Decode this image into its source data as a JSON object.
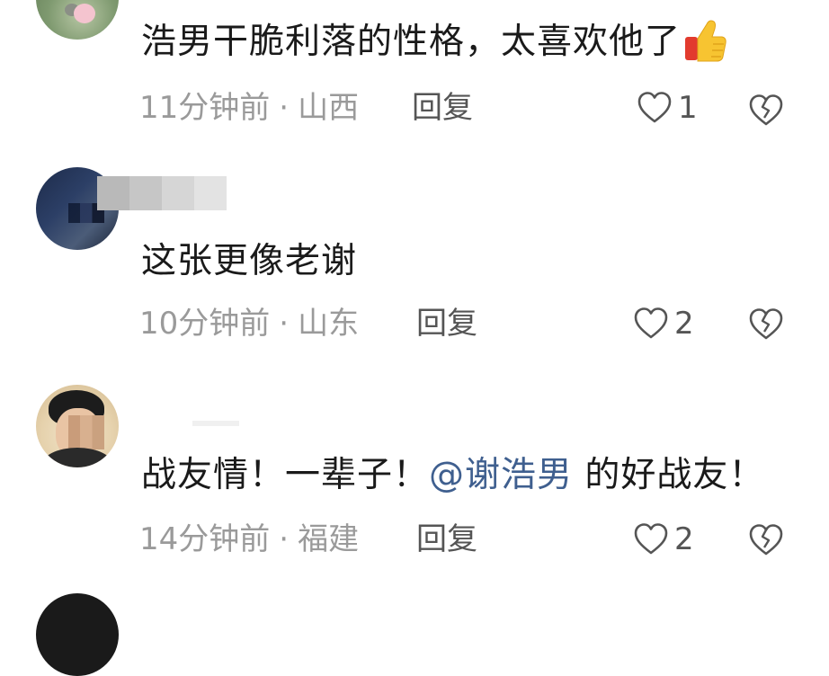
{
  "comments": [
    {
      "text": "浩男干脆利落的性格，太喜欢他了",
      "emoji": "thumbs-up",
      "time": "11分钟前",
      "location": "山西",
      "reply_label": "回复",
      "likes": "1"
    },
    {
      "text": "这张更像老谢",
      "time": "10分钟前",
      "location": "山东",
      "reply_label": "回复",
      "likes": "2"
    },
    {
      "text_before": "战友情！一辈子！",
      "mention": "@谢浩男",
      "text_after": " 的好战友！",
      "time": "14分钟前",
      "location": "福建",
      "reply_label": "回复",
      "likes": "2"
    }
  ],
  "separator": "·",
  "colors": {
    "text": "#1a1a1a",
    "meta": "#9a9a9a",
    "mention": "#3f5f8f",
    "icon": "#555555"
  }
}
